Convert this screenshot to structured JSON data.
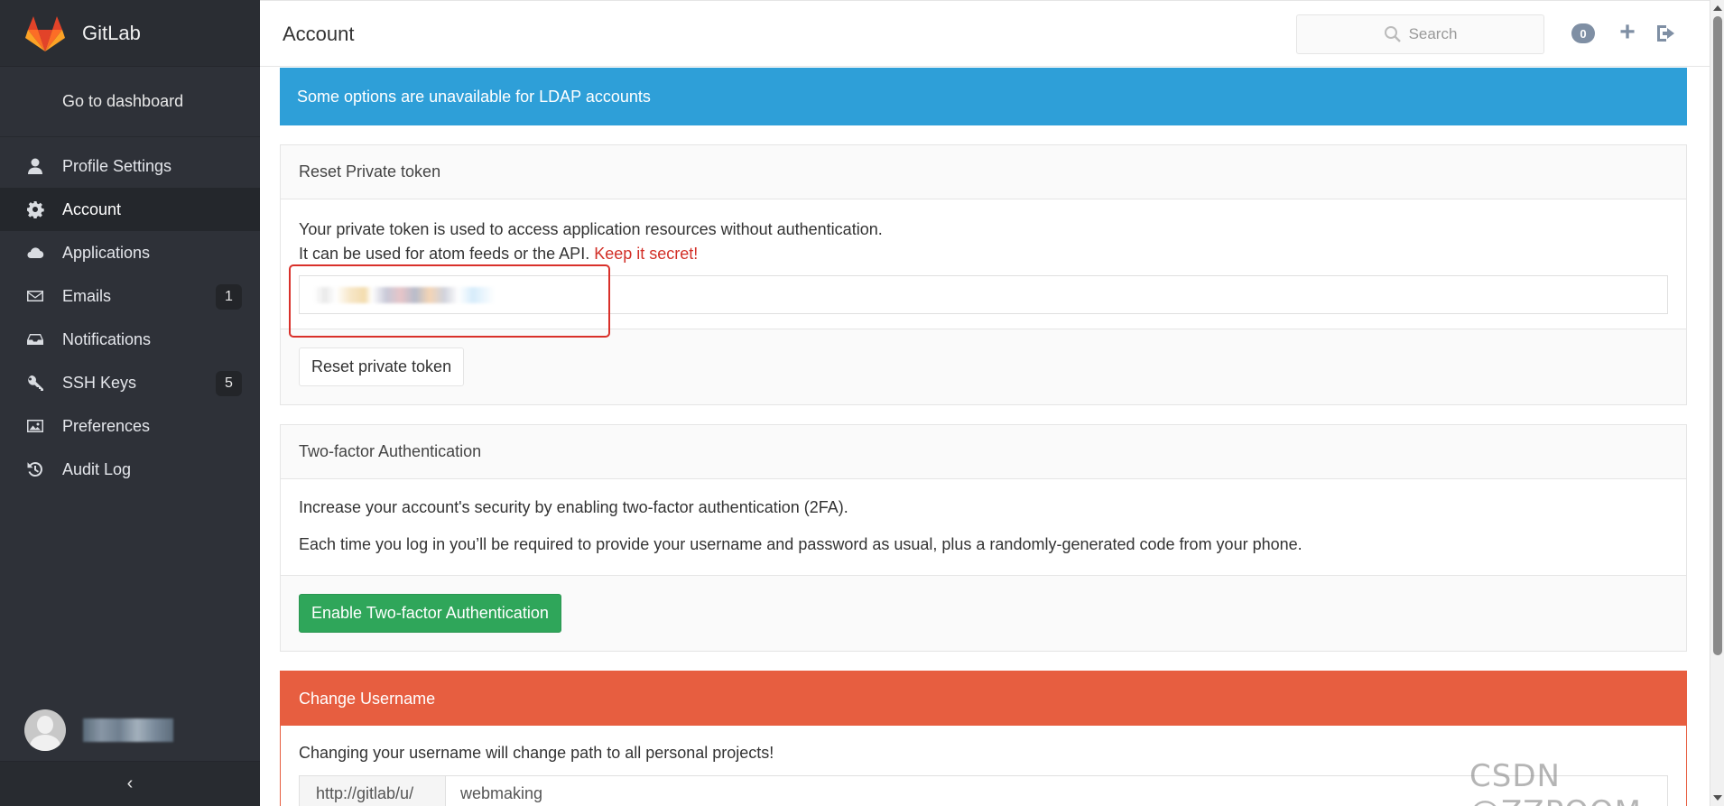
{
  "sidebar": {
    "brand": "GitLab",
    "goto": "Go to dashboard",
    "items": [
      {
        "label": "Profile Settings",
        "icon": "user-icon"
      },
      {
        "label": "Account",
        "icon": "gear-icon",
        "active": true
      },
      {
        "label": "Applications",
        "icon": "cloud-icon"
      },
      {
        "label": "Emails",
        "icon": "envelope-icon",
        "count": "1"
      },
      {
        "label": "Notifications",
        "icon": "inbox-icon"
      },
      {
        "label": "SSH Keys",
        "icon": "key-icon",
        "count": "5"
      },
      {
        "label": "Preferences",
        "icon": "image-icon"
      },
      {
        "label": "Audit Log",
        "icon": "history-icon"
      }
    ],
    "collapse": "‹"
  },
  "header": {
    "title": "Account",
    "search_placeholder": "Search",
    "todo_count": "0"
  },
  "alert": "Some options are unavailable for LDAP accounts",
  "private_token": {
    "heading": "Reset Private token",
    "line1": "Your private token is used to access application resources without authentication.",
    "line2": "It can be used for atom feeds or the API.",
    "keep_secret": "Keep it secret!",
    "button": "Reset private token"
  },
  "two_factor": {
    "heading": "Two-factor Authentication",
    "line1": "Increase your account's security by enabling two-factor authentication (2FA).",
    "line2": "Each time you log in you’ll be required to provide your username and password as usual, plus a randomly-generated code from your phone.",
    "button": "Enable Two-factor Authentication"
  },
  "change_username": {
    "heading": "Change Username",
    "text": "Changing your username will change path to all personal projects!",
    "url_prefix": "http://gitlab/u/",
    "url_value": "webmaking"
  },
  "watermark": "CSDN @ZZPOOM",
  "colors": {
    "sidebar_bg": "#2e3138",
    "alert_blue": "#2e9fd8",
    "danger_orange": "#e75e40",
    "success_green": "#2fa65a",
    "secret_red": "#d22f27"
  }
}
